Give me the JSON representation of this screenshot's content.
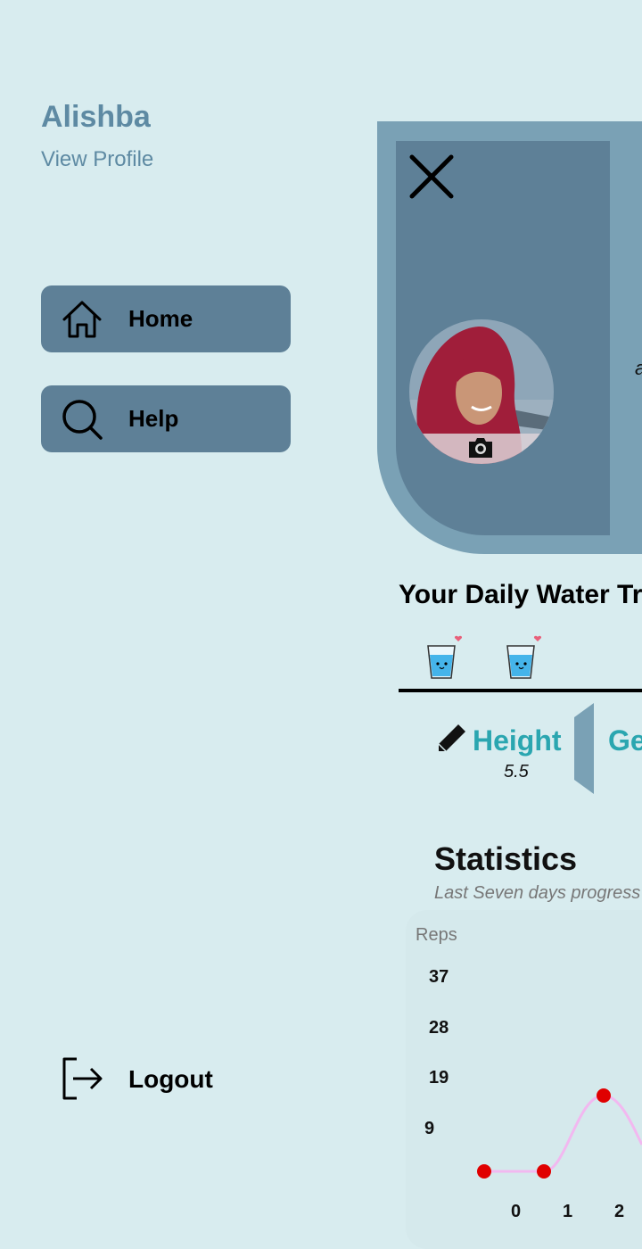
{
  "drawer": {
    "user_name": "Alishba",
    "view_profile": "View Profile",
    "nav": [
      {
        "label": "Home",
        "icon": "home-icon"
      },
      {
        "label": "Help",
        "icon": "search-icon"
      }
    ],
    "logout_label": "Logout"
  },
  "main": {
    "partial_text": "a",
    "water_title": "Your Daily Water Tr",
    "glasses": [
      "water-glass-icon",
      "water-glass-icon"
    ],
    "height_label": "Height",
    "height_value": "5.5",
    "gender_label": "Ge",
    "stats_title": "Statistics",
    "stats_subtitle": "Last Seven days progress"
  },
  "colors": {
    "background": "#d8ecef",
    "nav_button": "#5e8097",
    "accent_teal": "#2aa6b0",
    "chart_line": "#f2b8f0",
    "chart_point": "#e00000"
  },
  "chart_data": {
    "type": "line",
    "ylabel": "Reps",
    "y_ticks": [
      "37",
      "28",
      "19",
      "9"
    ],
    "x_ticks": [
      "0",
      "1",
      "2"
    ],
    "x": [
      0,
      1,
      2
    ],
    "values": [
      0,
      0,
      14
    ]
  }
}
